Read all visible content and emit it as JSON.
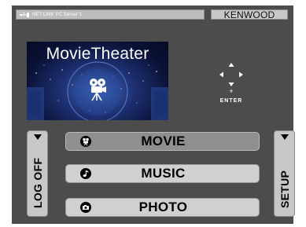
{
  "status_bar": {
    "network_icon": "network-link-icon",
    "network_label": "NET LINK PC Server 1",
    "brand": "KENWOOD"
  },
  "banner": {
    "title": "MovieTheater",
    "icon": "film-camera-icon"
  },
  "navigation": {
    "enter_label": "ENTER",
    "plus": "+"
  },
  "side_buttons": {
    "left": {
      "label": "LOG OFF",
      "icon": "triangle-down-icon"
    },
    "right": {
      "label": "SETUP",
      "icon": "triangle-down-icon"
    }
  },
  "menu": {
    "items": [
      {
        "label": "MOVIE",
        "icon": "film-camera-icon",
        "selected": true
      },
      {
        "label": "MUSIC",
        "icon": "music-note-icon",
        "selected": false
      },
      {
        "label": "PHOTO",
        "icon": "camera-icon",
        "selected": false
      }
    ]
  },
  "colors": {
    "screen_background": "#4c4c4c",
    "button_face": "#d0d0d0",
    "button_selected": "#8f8f8f"
  }
}
